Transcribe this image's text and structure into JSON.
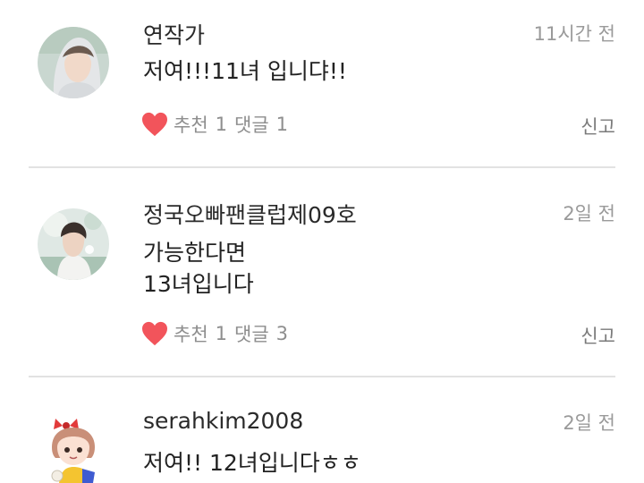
{
  "comments": [
    {
      "user": "연작가",
      "time": "11시간 전",
      "text": " 저여!!!11녀 입니댜!!",
      "like_label": "추천",
      "like_count": "1",
      "reply_label": "댓글",
      "reply_count": "1",
      "report": "신고"
    },
    {
      "user": "정국오빠팬클럽제09호",
      "time": "2일 전",
      "text": "가능한다면\n13녀입니다",
      "like_label": "추천",
      "like_count": "1",
      "reply_label": "댓글",
      "reply_count": "3",
      "report": "신고"
    },
    {
      "user": "serahkim2008",
      "time": "2일 전",
      "text": "저여!! 12녀입니다ㅎㅎ"
    }
  ],
  "colors": {
    "heart": "#f2545b",
    "meta_text": "#8e8e8e",
    "divider": "#e2e2e2"
  },
  "icons": {
    "like": "heart-icon"
  }
}
